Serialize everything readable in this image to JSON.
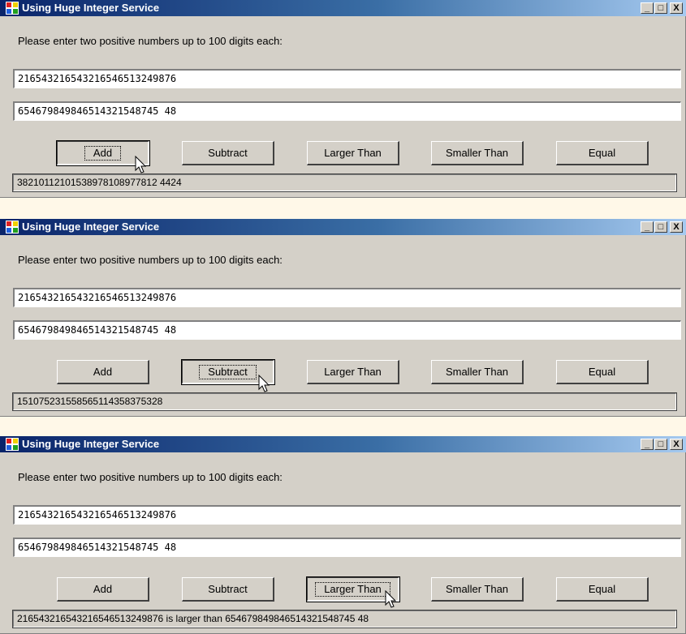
{
  "window": {
    "title": "Using Huge Integer Service",
    "prompt": "Please enter two positive numbers up to 100 digits each:",
    "controls": {
      "minimize": "_",
      "maximize": "□",
      "close": "X"
    }
  },
  "buttons": {
    "add": "Add",
    "subtract": "Subtract",
    "larger": "Larger Than",
    "smaller": "Smaller Than",
    "equal": "Equal"
  },
  "screens": [
    {
      "first": "216543216543216546513249876",
      "second": "654679849846514321548745 48",
      "result": "38210112101538978108977812 4424",
      "pressed": "add"
    },
    {
      "first": "216543216543216546513249876",
      "second": "654679849846514321548745 48",
      "result": "151075231558565114358375328",
      "pressed": "subtract"
    },
    {
      "first": "216543216543216546513249876",
      "second": "654679849846514321548745 48",
      "result": "216543216543216546513249876  is  larger  than  654679849846514321548745 48",
      "pressed": "larger"
    }
  ]
}
